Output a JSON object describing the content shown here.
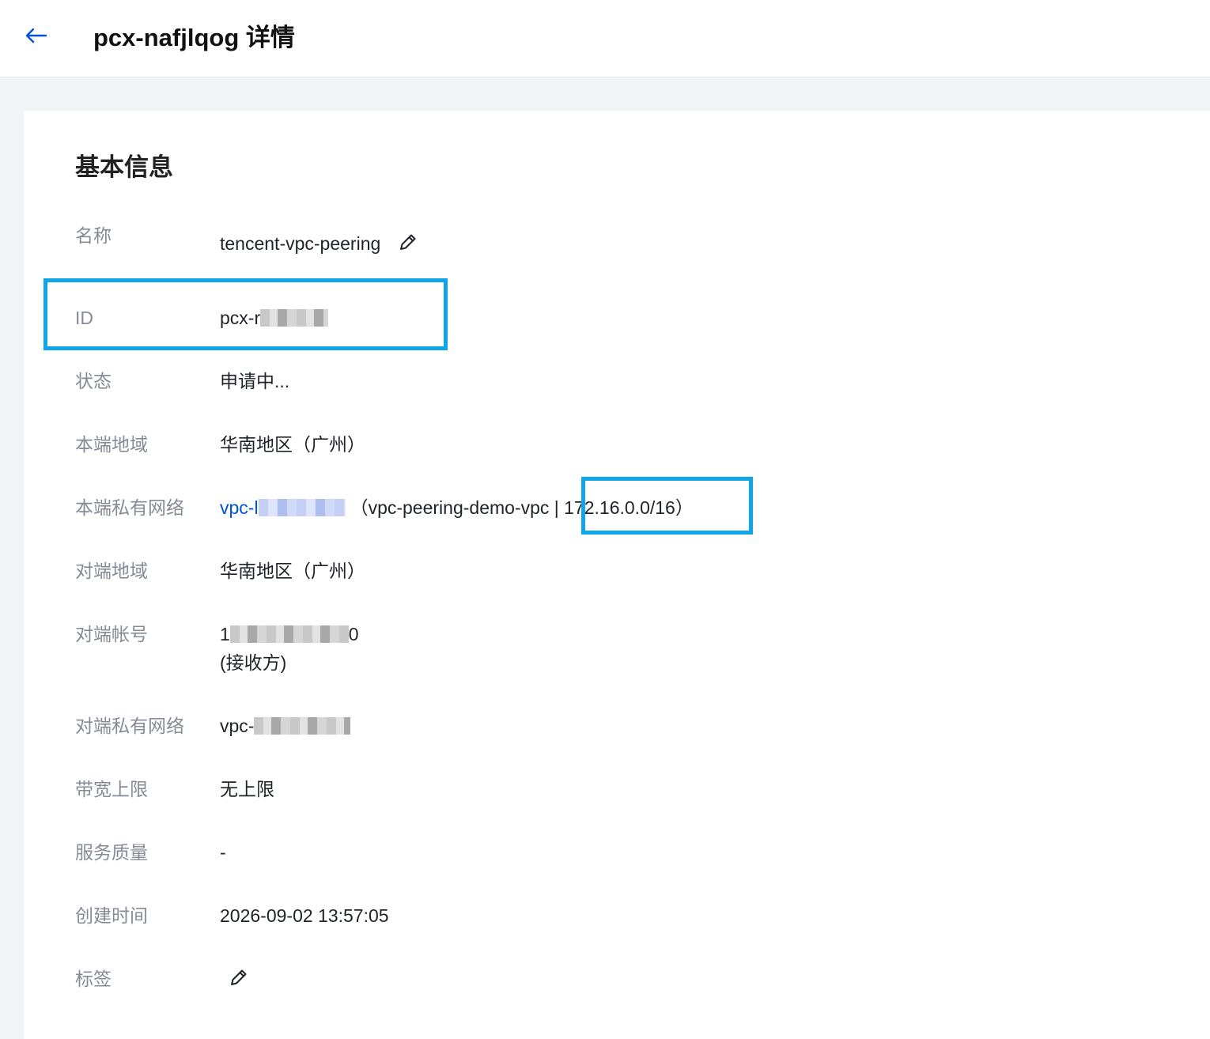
{
  "header": {
    "title": "pcx-nafjlqog 详情",
    "back_icon": "arrow-left-icon"
  },
  "section": {
    "title": "基本信息"
  },
  "fields": {
    "name": {
      "label": "名称",
      "value": "tencent-vpc-peering"
    },
    "id": {
      "label": "ID",
      "value_prefix": "pcx-r"
    },
    "status": {
      "label": "状态",
      "value": "申请中..."
    },
    "local_region": {
      "label": "本端地域",
      "value": "华南地区（广州）"
    },
    "local_vpc": {
      "label": "本端私有网络",
      "link_prefix": "vpc-l",
      "detail_open": "（",
      "detail_name": "vpc-peering-demo-vpc",
      "detail_cidr": " | 172.16.0.0/16）"
    },
    "peer_region": {
      "label": "对端地域",
      "value": "华南地区（广州）"
    },
    "peer_account": {
      "label": "对端帐号",
      "value_prefix": "1",
      "value_suffix": "0",
      "role": "(接收方)"
    },
    "peer_vpc": {
      "label": "对端私有网络",
      "value_prefix": "vpc-"
    },
    "bandwidth": {
      "label": "带宽上限",
      "value": "无上限"
    },
    "qos": {
      "label": "服务质量",
      "value": "-"
    },
    "created": {
      "label": "创建时间",
      "value": "2026-09-02 13:57:05"
    },
    "tags": {
      "label": "标签"
    }
  },
  "colors": {
    "link": "#0052d9",
    "highlight": "#0ea5e9",
    "label": "#858b96",
    "value": "#1f2329"
  }
}
